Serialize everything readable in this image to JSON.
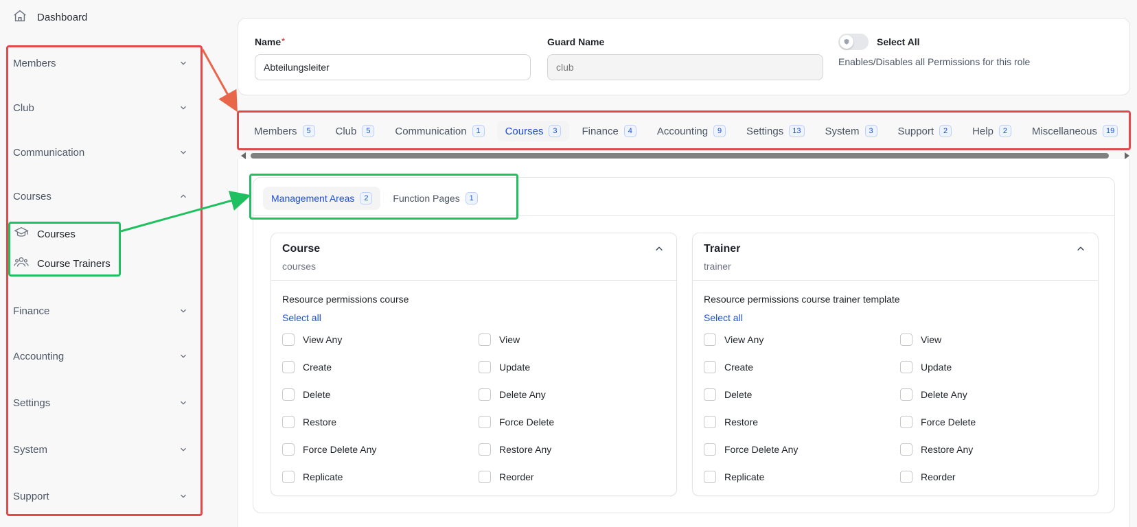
{
  "sidebar": {
    "dashboard": "Dashboard",
    "groups": [
      {
        "label": "Members",
        "expanded": false
      },
      {
        "label": "Club",
        "expanded": false
      },
      {
        "label": "Communication",
        "expanded": false
      },
      {
        "label": "Courses",
        "expanded": true
      },
      {
        "label": "Finance",
        "expanded": false
      },
      {
        "label": "Accounting",
        "expanded": false
      },
      {
        "label": "Settings",
        "expanded": false
      },
      {
        "label": "System",
        "expanded": false
      },
      {
        "label": "Support",
        "expanded": false
      }
    ],
    "course_items": [
      {
        "label": "Courses",
        "icon": "graduation-cap-icon"
      },
      {
        "label": "Course Trainers",
        "icon": "users-icon"
      }
    ]
  },
  "form": {
    "name_label": "Name",
    "name_required_mark": "*",
    "name_value": "Abteilungsleiter",
    "guard_label": "Guard Name",
    "guard_placeholder": "club",
    "select_all_label": "Select All",
    "select_all_help": "Enables/Disables all Permissions for this role",
    "select_all_on": false
  },
  "tabs": [
    {
      "label": "Members",
      "count": "5"
    },
    {
      "label": "Club",
      "count": "5"
    },
    {
      "label": "Communication",
      "count": "1"
    },
    {
      "label": "Courses",
      "count": "3",
      "active": true
    },
    {
      "label": "Finance",
      "count": "4"
    },
    {
      "label": "Accounting",
      "count": "9"
    },
    {
      "label": "Settings",
      "count": "13"
    },
    {
      "label": "System",
      "count": "3"
    },
    {
      "label": "Support",
      "count": "2"
    },
    {
      "label": "Help",
      "count": "2"
    },
    {
      "label": "Miscellaneous",
      "count": "19"
    }
  ],
  "subtabs": [
    {
      "label": "Management Areas",
      "count": "2",
      "active": true
    },
    {
      "label": "Function Pages",
      "count": "1"
    }
  ],
  "resources": [
    {
      "title": "Course",
      "slug": "courses",
      "permissions_title": "Resource permissions course",
      "select_all": "Select all",
      "permissions": [
        "View Any",
        "View",
        "Create",
        "Update",
        "Delete",
        "Delete Any",
        "Restore",
        "Force Delete",
        "Force Delete Any",
        "Restore Any",
        "Replicate",
        "Reorder"
      ]
    },
    {
      "title": "Trainer",
      "slug": "trainer",
      "permissions_title": "Resource permissions course trainer template",
      "select_all": "Select all",
      "permissions": [
        "View Any",
        "View",
        "Create",
        "Update",
        "Delete",
        "Delete Any",
        "Restore",
        "Force Delete",
        "Force Delete Any",
        "Restore Any",
        "Replicate",
        "Reorder"
      ]
    }
  ],
  "colors": {
    "accent": "#1d4ed8",
    "annotation_red": "#e04a4a",
    "annotation_green": "#20c060"
  }
}
